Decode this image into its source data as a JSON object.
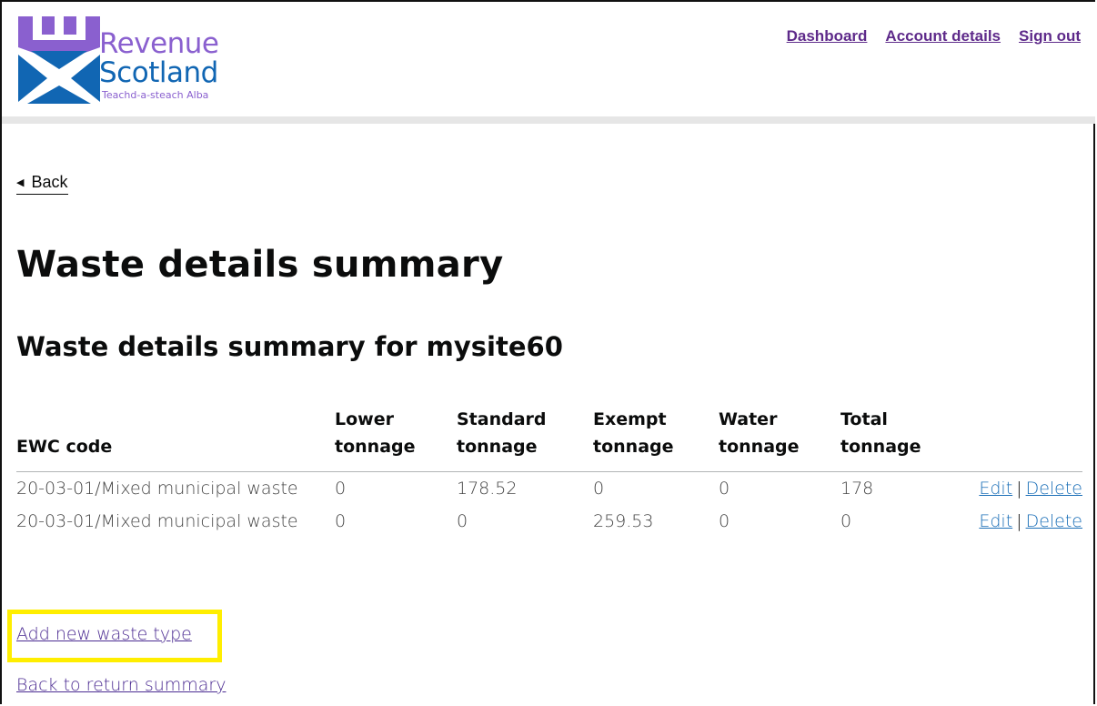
{
  "brand": {
    "line1": "Revenue",
    "line2": "Scotland",
    "line3": "Teachd-a-steach Alba",
    "purple": "#8a60cf",
    "blue": "#1166b3"
  },
  "nav": {
    "dashboard": "Dashboard",
    "account_details": "Account details",
    "sign_out": "Sign out"
  },
  "back_link": "Back",
  "page_title": "Waste details summary",
  "section_title": "Waste details summary for mysite60",
  "table": {
    "headers": [
      "EWC code",
      "Lower tonnage",
      "Standard tonnage",
      "Exempt tonnage",
      "Water tonnage",
      "Total tonnage"
    ],
    "rows": [
      {
        "ewc": "20-03-01/Mixed municipal waste",
        "lower": "0",
        "standard": "178.52",
        "exempt": "0",
        "water": "0",
        "total": "178",
        "edit": "Edit",
        "delete": "Delete"
      },
      {
        "ewc": "20-03-01/Mixed municipal waste",
        "lower": "0",
        "standard": "0",
        "exempt": "259.53",
        "water": "0",
        "total": "0",
        "edit": "Edit",
        "delete": "Delete"
      }
    ],
    "separator": "|"
  },
  "add_new_waste_type": "Add new waste type",
  "back_to_return_summary": "Back to return summary",
  "highlight_color": "#ffee00"
}
